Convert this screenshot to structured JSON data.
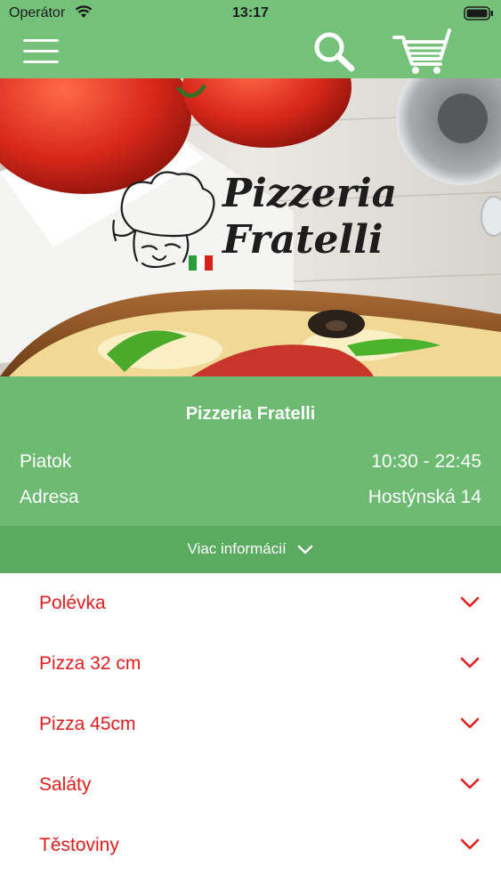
{
  "status_bar": {
    "carrier": "Operátor",
    "time": "13:17"
  },
  "nav": {
    "menu_icon": "hamburger-icon",
    "search_icon": "search-icon",
    "cart_icon": "cart-icon"
  },
  "hero": {
    "logo_line1": "Pizzeria",
    "logo_line2": "Fratelli"
  },
  "restaurant": {
    "name": "Pizzeria Fratelli",
    "rows": [
      {
        "label": "Piatok",
        "value": "10:30 - 22:45"
      },
      {
        "label": "Adresa",
        "value": "Hostýnská 14"
      }
    ],
    "more_label": "Viac informácií"
  },
  "categories": [
    {
      "label": "Polévka"
    },
    {
      "label": "Pizza 32 cm"
    },
    {
      "label": "Pizza 45cm"
    },
    {
      "label": "Saláty"
    },
    {
      "label": "Těstoviny"
    }
  ],
  "colors": {
    "header": "#74c27a",
    "info": "#6dbb72",
    "more": "#5aab60",
    "category_text": "#e01d1d"
  }
}
